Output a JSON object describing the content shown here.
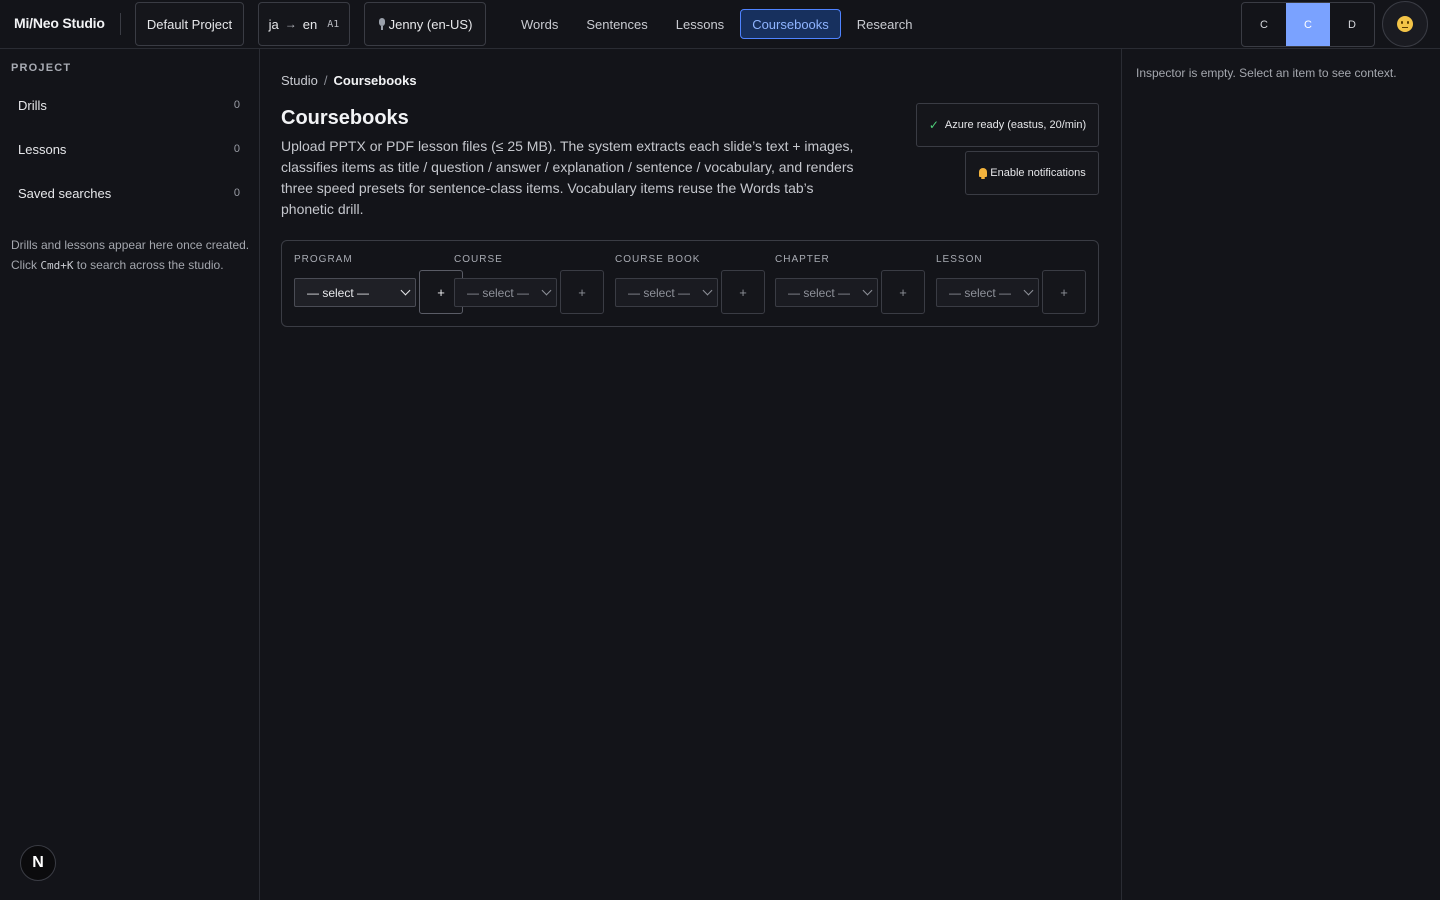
{
  "app": {
    "brand": "Mi/Neo Studio"
  },
  "header": {
    "project": "Default Project",
    "lang_from": "ja",
    "lang_arrow": "→",
    "lang_to": "en",
    "level": "A1",
    "voice": "Jenny (en-US)",
    "nav": [
      "Words",
      "Sentences",
      "Lessons",
      "Coursebooks",
      "Research"
    ],
    "active_nav": "Coursebooks",
    "segments": [
      "C",
      "C",
      "D"
    ],
    "active_segment_index": 1,
    "accent_color": "#4f83ff"
  },
  "sidebar": {
    "title": "PROJECT",
    "items": [
      {
        "label": "Drills",
        "count": "0"
      },
      {
        "label": "Lessons",
        "count": "0"
      },
      {
        "label": "Saved searches",
        "count": "0"
      }
    ],
    "note_before": "Drills and lessons appear here once created. Click ",
    "note_shortcut": "Cmd+K",
    "note_after": " to search across the studio.",
    "badge": "N"
  },
  "main": {
    "breadcrumb": {
      "root": "Studio",
      "sep": "/",
      "current": "Coursebooks"
    },
    "title": "Coursebooks",
    "description": "Upload PPTX or PDF lesson files (≤ 25 MB). The system extracts each slide’s text + images, classifies items as title / question / answer / explanation / sentence / vocabulary, and renders three speed presets for sentence-class items. Vocabulary items reuse the Words tab’s phonetic drill.",
    "status": {
      "check": "✓",
      "text": "Azure ready (eastus, 20/min)",
      "color": "#4fd07a"
    },
    "notifications_label": "Enable notifications",
    "pickers": [
      {
        "label": "PROGRAM",
        "value": "— select —",
        "add": "+",
        "enabled": true
      },
      {
        "label": "COURSE",
        "value": "— select —",
        "add": "+",
        "enabled": false
      },
      {
        "label": "COURSE BOOK",
        "value": "— select —",
        "add": "+",
        "enabled": false
      },
      {
        "label": "CHAPTER",
        "value": "— select —",
        "add": "+",
        "enabled": false
      },
      {
        "label": "LESSON",
        "value": "— select —",
        "add": "+",
        "enabled": false
      }
    ]
  },
  "inspector": {
    "empty_text": "Inspector is empty. Select an item to see context."
  }
}
